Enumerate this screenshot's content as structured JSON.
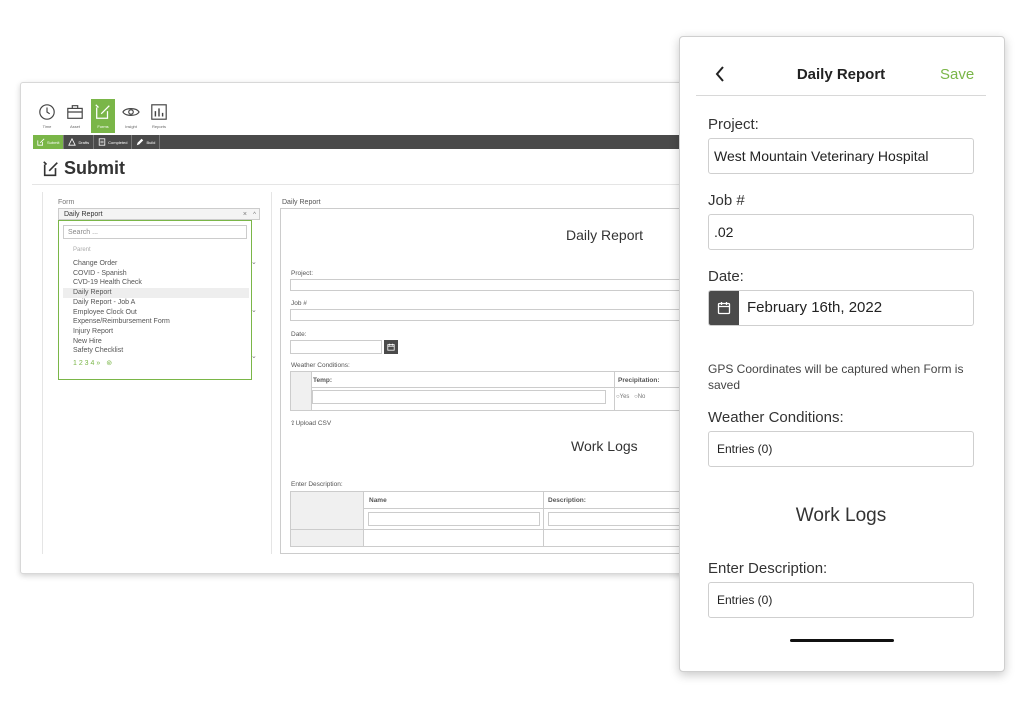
{
  "desktop": {
    "nav": [
      {
        "label": "Time",
        "icon": "clock-icon"
      },
      {
        "label": "Asset",
        "icon": "briefcase-icon"
      },
      {
        "label": "Forms",
        "icon": "forms-icon",
        "active": true
      },
      {
        "label": "Insight",
        "icon": "eye-icon"
      },
      {
        "label": "Reports",
        "icon": "chart-icon"
      }
    ],
    "toolbar": [
      {
        "label": "Submit",
        "icon": "forms-icon",
        "active": true
      },
      {
        "label": "Drafts",
        "icon": "warning-icon"
      },
      {
        "label": "Completed",
        "icon": "document-icon"
      },
      {
        "label": "Build",
        "icon": "pen-icon"
      }
    ],
    "page_title": "Submit",
    "form_label": "Form",
    "form_selected": "Daily Report",
    "form_clear": "×",
    "form_caret": "^",
    "search_placeholder": "Search ...",
    "group_label": "Parent",
    "form_options": [
      "Change Order",
      "COVID - Spanish",
      "CVD-19 Health Check",
      "Daily Report",
      "Daily Report - Job A",
      "Employee Clock Out",
      "Expense/Reimbursement Form",
      "Injury Report",
      "New Hire",
      "Safety Checklist"
    ],
    "pagination": "1 2 3 4 »",
    "preview": {
      "tab_label": "Daily Report",
      "title": "Daily Report",
      "project_label": "Project:",
      "job_label": "Job #",
      "date_label": "Date:",
      "weather_label": "Weather Conditions:",
      "temp_header": "Temp:",
      "precip_header": "Precipitation:",
      "radio_yes": "Yes",
      "radio_no": "No",
      "upload_label": "Upload CSV",
      "worklogs_title": "Work Logs",
      "enter_desc_label": "Enter Description:",
      "name_header": "Name",
      "desc_header": "Description:"
    }
  },
  "mobile": {
    "title": "Daily Report",
    "save_label": "Save",
    "project_label": "Project:",
    "project_value": "West Mountain Veterinary Hospital",
    "job_label": "Job #",
    "job_value": ".02",
    "date_label": "Date:",
    "date_value": "February 16th, 2022",
    "gps_note": "GPS Coordinates will be captured when Form is saved",
    "weather_label": "Weather Conditions:",
    "weather_entries": "Entries (0)",
    "worklogs_title": "Work Logs",
    "enter_desc_label": "Enter Description:",
    "desc_entries": "Entries (0)"
  },
  "colors": {
    "accent": "#7ab648",
    "dark": "#4a4a4a"
  }
}
